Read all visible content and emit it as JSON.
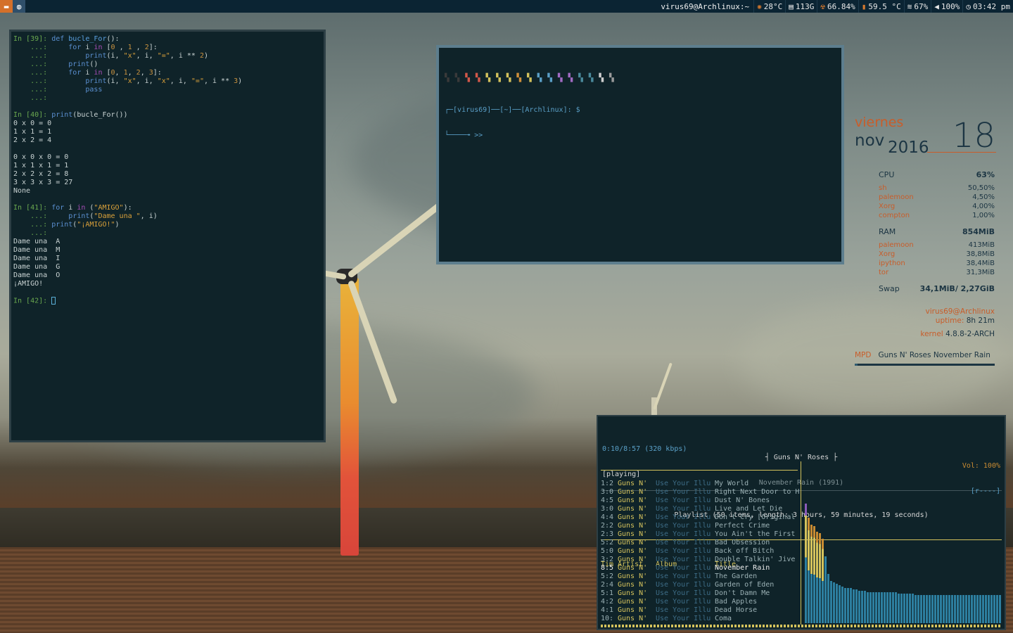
{
  "topbar": {
    "title": "virus69@Archlinux:~",
    "temp_cpu": "28°C",
    "disk": "113G",
    "cpu_pct": "66.84%",
    "temp2": "59.5 °C",
    "wifi": "67%",
    "volume": "100%",
    "clock": "03:42 pm"
  },
  "ipython": {
    "lines": [
      [
        [
          "c-prompt",
          "In [39]: "
        ],
        [
          "c-kw",
          "def "
        ],
        [
          "c-fn",
          "bucle_For"
        ],
        [
          "",
          "():"
        ]
      ],
      [
        [
          "c-cont",
          "    ...:     "
        ],
        [
          "c-kw",
          "for "
        ],
        [
          "",
          "i "
        ],
        [
          "c-kw2",
          "in "
        ],
        [
          "",
          "["
        ],
        [
          "c-num",
          "0"
        ],
        [
          "",
          " , "
        ],
        [
          "c-num",
          "1"
        ],
        [
          "",
          " , "
        ],
        [
          "c-num",
          "2"
        ],
        [
          "",
          "]:"
        ]
      ],
      [
        [
          "c-cont",
          "    ...:         "
        ],
        [
          "c-kw",
          "print"
        ],
        [
          "",
          "(i, "
        ],
        [
          "c-str",
          "\"x\""
        ],
        [
          "",
          ", i, "
        ],
        [
          "c-str",
          "\"=\""
        ],
        [
          "",
          ", i ** "
        ],
        [
          "c-num",
          "2"
        ],
        [
          "",
          ")"
        ]
      ],
      [
        [
          "c-cont",
          "    ...:     "
        ],
        [
          "c-kw",
          "print"
        ],
        [
          "",
          "()"
        ]
      ],
      [
        [
          "c-cont",
          "    ...:     "
        ],
        [
          "c-kw",
          "for "
        ],
        [
          "",
          "i "
        ],
        [
          "c-kw2",
          "in "
        ],
        [
          "",
          "["
        ],
        [
          "c-num",
          "0"
        ],
        [
          "",
          ", "
        ],
        [
          "c-num",
          "1"
        ],
        [
          "",
          ", "
        ],
        [
          "c-num",
          "2"
        ],
        [
          "",
          ", "
        ],
        [
          "c-num",
          "3"
        ],
        [
          "",
          "]:"
        ]
      ],
      [
        [
          "c-cont",
          "    ...:         "
        ],
        [
          "c-kw",
          "print"
        ],
        [
          "",
          "(i, "
        ],
        [
          "c-str",
          "\"x\""
        ],
        [
          "",
          ", i, "
        ],
        [
          "c-str",
          "\"x\""
        ],
        [
          "",
          ", i, "
        ],
        [
          "c-str",
          "\"=\""
        ],
        [
          "",
          ", i ** "
        ],
        [
          "c-num",
          "3"
        ],
        [
          "",
          ")"
        ]
      ],
      [
        [
          "c-cont",
          "    ...:         "
        ],
        [
          "c-kw",
          "pass"
        ]
      ],
      [
        [
          "c-cont",
          "    ...:"
        ]
      ],
      [
        [
          "",
          ""
        ]
      ],
      [
        [
          "c-prompt",
          "In [40]: "
        ],
        [
          "c-kw",
          "print"
        ],
        [
          "",
          "(bucle_For())"
        ]
      ],
      [
        [
          "",
          "0 x 0 = 0"
        ]
      ],
      [
        [
          "",
          "1 x 1 = 1"
        ]
      ],
      [
        [
          "",
          "2 x 2 = 4"
        ]
      ],
      [
        [
          "",
          ""
        ]
      ],
      [
        [
          "",
          "0 x 0 x 0 = 0"
        ]
      ],
      [
        [
          "",
          "1 x 1 x 1 = 1"
        ]
      ],
      [
        [
          "",
          "2 x 2 x 2 = 8"
        ]
      ],
      [
        [
          "",
          "3 x 3 x 3 = 27"
        ]
      ],
      [
        [
          "",
          "None"
        ]
      ],
      [
        [
          "",
          ""
        ]
      ],
      [
        [
          "c-prompt",
          "In [41]: "
        ],
        [
          "c-kw",
          "for "
        ],
        [
          "",
          "i "
        ],
        [
          "c-kw2",
          "in "
        ],
        [
          "",
          "("
        ],
        [
          "c-str",
          "\"AMIGO\""
        ],
        [
          "",
          "):"
        ]
      ],
      [
        [
          "c-cont",
          "    ...:     "
        ],
        [
          "c-kw",
          "print"
        ],
        [
          "",
          "("
        ],
        [
          "c-str",
          "\"Dame una \""
        ],
        [
          "",
          ", i)"
        ]
      ],
      [
        [
          "c-cont",
          "    ...: "
        ],
        [
          "c-kw",
          "print"
        ],
        [
          "",
          "("
        ],
        [
          "c-str",
          "\"¡AMIGO!\""
        ],
        [
          "",
          ")"
        ]
      ],
      [
        [
          "c-cont",
          "    ...:"
        ]
      ],
      [
        [
          "",
          "Dame una  A"
        ]
      ],
      [
        [
          "",
          "Dame una  M"
        ]
      ],
      [
        [
          "",
          "Dame una  I"
        ]
      ],
      [
        [
          "",
          "Dame una  G"
        ]
      ],
      [
        [
          "",
          "Dame una  O"
        ]
      ],
      [
        [
          "",
          "¡AMIGO!"
        ]
      ],
      [
        [
          "",
          ""
        ]
      ],
      [
        [
          "c-prompt",
          "In [42]: "
        ]
      ]
    ]
  },
  "shell": {
    "swatch_colors": [
      "#3a3a3a",
      "#3a3a3a",
      "#d2584a",
      "#d2584a",
      "#d4c25c",
      "#d4c25c",
      "#d4c25c",
      "#d0903a",
      "#d4c25c",
      "#5a9fc7",
      "#5a9fc7",
      "#a26bc4",
      "#a26bc4",
      "#4a8a9c",
      "#4a8a9c",
      "#cfcfcf",
      "#9a9a9a"
    ],
    "prompt_line1": "┌─[virus69]──[~]──[Archlinux]: $",
    "prompt_line2": "└────╼ >>"
  },
  "conky": {
    "day": "viernes",
    "month": "nov",
    "year": "2016",
    "date": "18",
    "cpu_label": "CPU",
    "cpu_value": "63%",
    "cpu_procs": [
      [
        "sh",
        "50,50%"
      ],
      [
        "palemoon",
        "4,50%"
      ],
      [
        "Xorg",
        "4,00%"
      ],
      [
        "compton",
        "1,00%"
      ]
    ],
    "ram_label": "RAM",
    "ram_value": "854MiB",
    "ram_procs": [
      [
        "palemoon",
        "413MiB"
      ],
      [
        "Xorg",
        "38,8MiB"
      ],
      [
        "ipython",
        "38,4MiB"
      ],
      [
        "tor",
        "31,3MiB"
      ]
    ],
    "swap_label": "Swap",
    "swap_value": "34,1MiB/ 2,27GiB",
    "user": "virus69@Archlinux",
    "uptime_label": "uptime:",
    "uptime_value": "8h 21m",
    "kernel_label": "kernel",
    "kernel_value": "4.8.8-2-ARCH",
    "mpd_label": "MPD",
    "mpd_track": "Guns N' Roses November Rain",
    "mpd_progress": 0.02
  },
  "ncmpcpp": {
    "time": "0:10/8:57 (320 kbps)",
    "artist": "┤ Guns N' Roses ├",
    "volume": "Vol: 100%",
    "state": "[playing]",
    "album": "November Rain (1991)",
    "flags": "[r----]",
    "playlist_info": "Playlist (50 items, length: 3 hours, 59 minutes, 19 seconds)",
    "headers": [
      "Tim",
      "Artist",
      "Album",
      "Title"
    ],
    "rows": [
      [
        "1:2",
        "Guns N'",
        "Use Your Illu",
        "My World"
      ],
      [
        "3:0",
        "Guns N'",
        "Use Your Illu",
        "Right Next Door to H"
      ],
      [
        "4:5",
        "Guns N'",
        "Use Your Illu",
        "Dust N' Bones"
      ],
      [
        "3:0",
        "Guns N'",
        "Use Your Illu",
        "Live and Let Die"
      ],
      [
        "4:4",
        "Guns N'",
        "Use Your Illu",
        "Don't Cry [Original"
      ],
      [
        "2:2",
        "Guns N'",
        "Use Your Illu",
        "Perfect Crime"
      ],
      [
        "2:3",
        "Guns N'",
        "Use Your Illu",
        "You Ain't the First"
      ],
      [
        "5:2",
        "Guns N'",
        "Use Your Illu",
        "Bad Obsession"
      ],
      [
        "5:0",
        "Guns N'",
        "Use Your Illu",
        "Back off Bitch"
      ],
      [
        "3:2",
        "Guns N'",
        "Use Your Illu",
        "Double Talkin' Jive"
      ],
      [
        "8:5",
        "Guns N'",
        "Use Your Illu",
        "November Rain"
      ],
      [
        "5:2",
        "Guns N'",
        "Use Your Illu",
        "The Garden"
      ],
      [
        "2:4",
        "Guns N'",
        "Use Your Illu",
        "Garden of Eden"
      ],
      [
        "5:1",
        "Guns N'",
        "Use Your Illu",
        "Don't Damn Me"
      ],
      [
        "4:2",
        "Guns N'",
        "Use Your Illu",
        "Bad Apples"
      ],
      [
        "4:1",
        "Guns N'",
        "Use Your Illu",
        "Dead Horse"
      ],
      [
        "10:",
        "Guns N'",
        "Use Your Illu",
        "Coma"
      ]
    ],
    "current_index": 10,
    "visualizer": [
      170,
      150,
      140,
      138,
      130,
      128,
      120,
      95,
      70,
      60,
      58,
      56,
      54,
      52,
      50,
      50,
      50,
      48,
      48,
      46,
      46,
      46,
      44,
      44,
      44,
      44,
      44,
      44,
      44,
      44,
      44,
      44,
      44,
      42,
      42,
      42,
      42,
      42,
      42,
      40,
      40,
      40,
      40,
      40,
      40,
      40,
      40,
      40,
      40,
      40,
      40,
      40,
      40,
      40,
      40,
      40,
      40,
      40,
      40,
      40,
      40,
      40,
      40,
      40,
      40,
      40,
      40,
      40,
      40,
      40
    ]
  }
}
